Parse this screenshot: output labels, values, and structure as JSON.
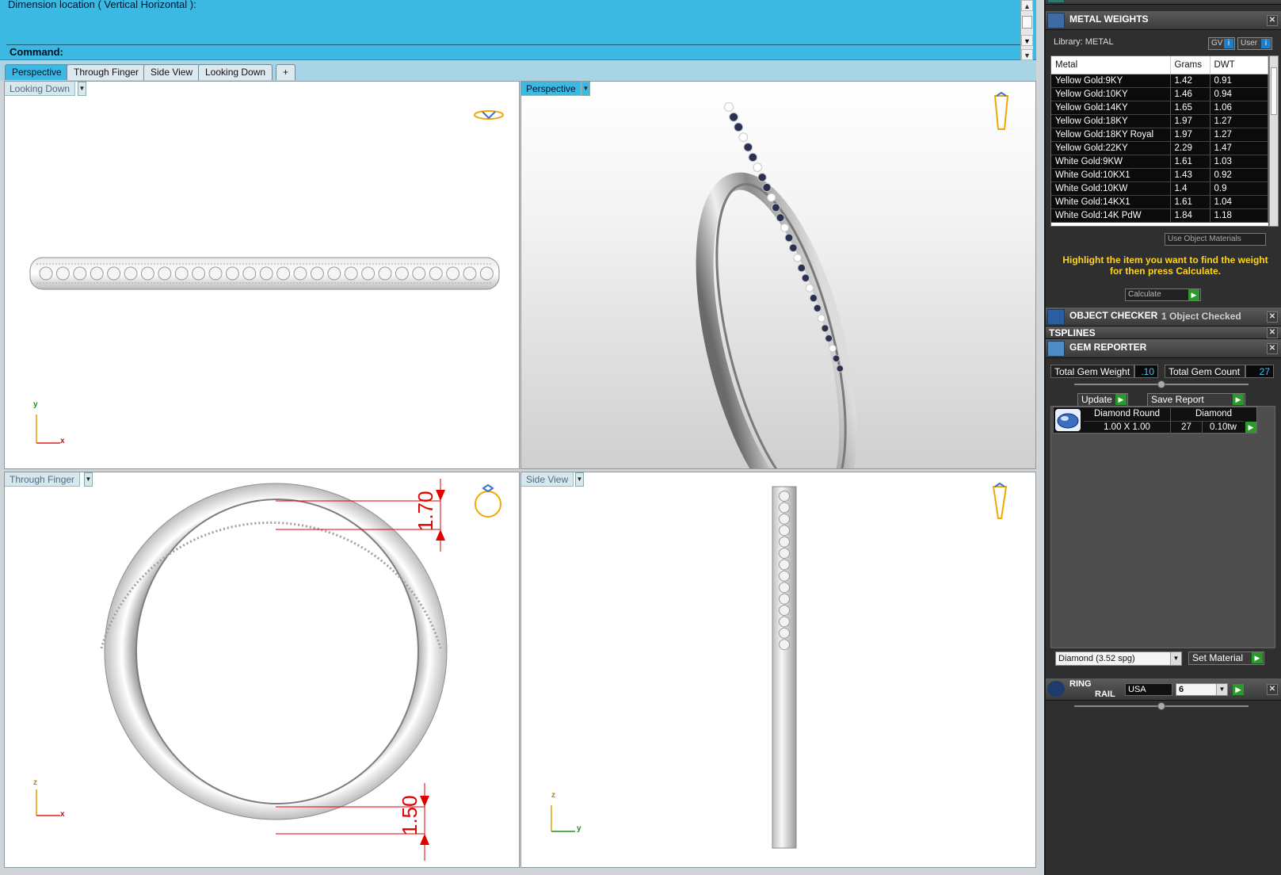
{
  "command": {
    "history_text": "Dimension location ( Vertical  Horizontal ):",
    "prompt_label": "Command:"
  },
  "tabs": [
    "Perspective",
    "Through Finger",
    "Side View",
    "Looking Down",
    "+"
  ],
  "viewports": {
    "looking_down": {
      "label": "Looking Down",
      "axis_y": "y",
      "axis_x": "x"
    },
    "perspective": {
      "label": "Perspective"
    },
    "through_finger": {
      "label": "Through Finger",
      "axis_z": "z",
      "axis_x": "x",
      "dim_top": "1.70",
      "dim_bottom": "1.50"
    },
    "side_view": {
      "label": "Side View",
      "axis_z": "z",
      "axis_y": "y"
    }
  },
  "metal_weights": {
    "title": "METAL WEIGHTS",
    "library_label": "Library: METAL",
    "gv_button": "GV",
    "user_button": "User",
    "columns": [
      "Metal",
      "Grams",
      "DWT"
    ],
    "rows": [
      [
        "Yellow Gold:9KY",
        "1.42",
        "0.91"
      ],
      [
        "Yellow Gold:10KY",
        "1.46",
        "0.94"
      ],
      [
        "Yellow Gold:14KY",
        "1.65",
        "1.06"
      ],
      [
        "Yellow Gold:18KY",
        "1.97",
        "1.27"
      ],
      [
        "Yellow Gold:18KY Royal",
        "1.97",
        "1.27"
      ],
      [
        "Yellow Gold:22KY",
        "2.29",
        "1.47"
      ],
      [
        "White Gold:9KW",
        "1.61",
        "1.03"
      ],
      [
        "White Gold:10KX1",
        "1.43",
        "0.92"
      ],
      [
        "White Gold:10KW",
        "1.4",
        "0.9"
      ],
      [
        "White Gold:14KX1",
        "1.61",
        "1.04"
      ],
      [
        "White Gold:14K PdW",
        "1.84",
        "1.18"
      ]
    ],
    "use_object_materials": "Use Object Materials",
    "hint": "Highlight the item you want to find the weight for then press Calculate.",
    "calculate_button": "Calculate"
  },
  "object_checker": {
    "title": "OBJECT CHECKER",
    "status": "1  Object Checked"
  },
  "tsplines": {
    "title": "TSPLINES"
  },
  "gem_reporter": {
    "title": "GEM REPORTER",
    "total_weight_label": "Total Gem Weight",
    "total_weight_value": ".10",
    "total_count_label": "Total Gem Count",
    "total_count_value": "27",
    "update_button": "Update",
    "save_report_button": "Save Report",
    "gem": {
      "name": "Diamond Round",
      "size": "1.00 X 1.00",
      "material": "Diamond",
      "count": "27",
      "weight": "0.10tw"
    },
    "material_select": "Diamond     (3.52 spg)",
    "set_material_button": "Set Material"
  },
  "ring_rail": {
    "title_line1": "RING",
    "title_line2": "RAIL",
    "standard": "USA",
    "size": "6"
  },
  "colors": {
    "command_bg": "#3cb9e3",
    "panel_bg": "#2f2f2f",
    "hint_yellow": "#ffd51a",
    "dimension_red": "#e10000",
    "accent_green": "#2a9a2a"
  }
}
